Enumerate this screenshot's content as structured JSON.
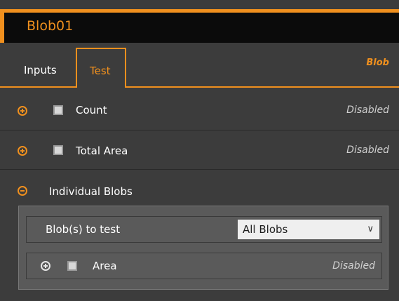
{
  "title": "Blob01",
  "tabs": [
    {
      "label": "Inputs"
    },
    {
      "label": "Test"
    }
  ],
  "panel_label": "Blob",
  "tests": [
    {
      "label": "Count",
      "status": "Disabled"
    },
    {
      "label": "Total Area",
      "status": "Disabled"
    }
  ],
  "individual": {
    "label": "Individual Blobs",
    "blobs_to_test": {
      "label": "Blob(s) to test",
      "value": "All Blobs"
    },
    "area": {
      "label": "Area",
      "status": "Disabled"
    }
  },
  "icons": {
    "expand": "plus-circle-icon",
    "collapse": "minus-circle-icon",
    "dropdown": "chevron-down-icon"
  },
  "colors": {
    "accent": "#f0901e",
    "background": "#3c3c3c"
  }
}
